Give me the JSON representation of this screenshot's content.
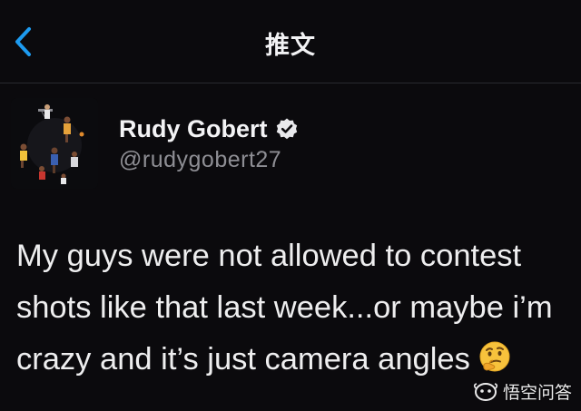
{
  "header": {
    "title": "推文",
    "back_icon": "chevron-left-icon",
    "accent_color": "#1d9bf0"
  },
  "author": {
    "display_name": "Rudy Gobert",
    "handle": "@rudygobert27",
    "verified_icon": "verified-badge-icon",
    "avatar_icon": "basketball-collage-avatar"
  },
  "tweet": {
    "lines": [
      "My guys were not allowed to contest",
      "shots like that last week...or maybe i’m",
      "crazy and it’s just camera angles"
    ],
    "emoji_icon": "thinking-face-emoji"
  },
  "watermark": {
    "text": "悟空问答",
    "logo_icon": "wukong-logo-icon"
  }
}
